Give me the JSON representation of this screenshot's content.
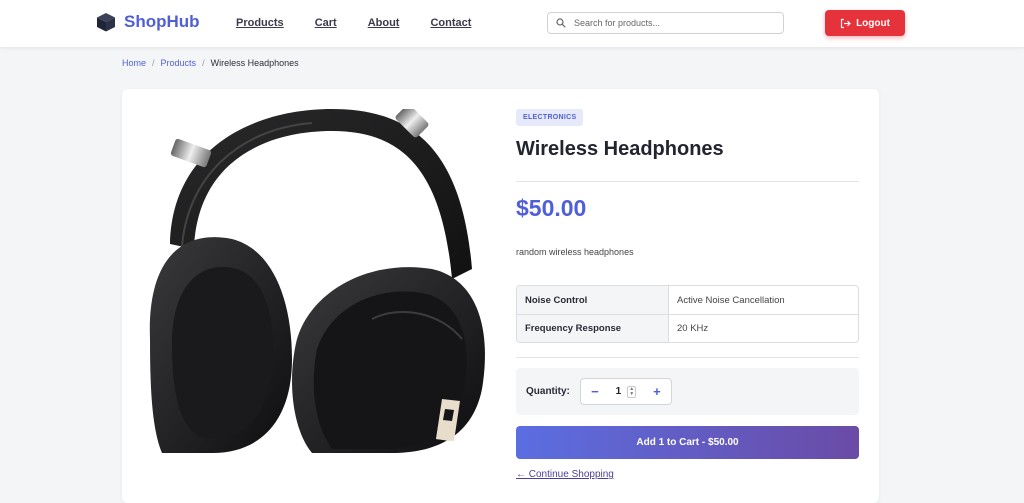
{
  "brand": {
    "name": "ShopHub",
    "icon": "cube-icon",
    "color": "#4f5fd8"
  },
  "nav": [
    "Products",
    "Cart",
    "About",
    "Contact"
  ],
  "search": {
    "placeholder": "Search for products...",
    "icon": "search-icon"
  },
  "logout": {
    "label": "Logout",
    "icon": "logout-icon",
    "color": "#e5323b"
  },
  "breadcrumb": {
    "home": "Home",
    "products": "Products",
    "separator": "/",
    "current": "Wireless Headphones"
  },
  "product": {
    "category": "ELECTRONICS",
    "title": "Wireless Headphones",
    "price": "$50.00",
    "description": "random wireless headphones",
    "specs": [
      {
        "key": "Noise Control",
        "value": "Active Noise Cancellation"
      },
      {
        "key": "Frequency Response",
        "value": "20 KHz"
      }
    ],
    "image": "wireless-headphones-image"
  },
  "quantity": {
    "label": "Quantity:",
    "value": "1",
    "minus": "−",
    "plus": "+"
  },
  "actions": {
    "add_to_cart": "Add 1 to Cart - $50.00",
    "continue": "← Continue Shopping"
  },
  "colors": {
    "accent": "#4f5fd8",
    "gradient_start": "#5b6ee1",
    "gradient_end": "#6a4ba6"
  }
}
